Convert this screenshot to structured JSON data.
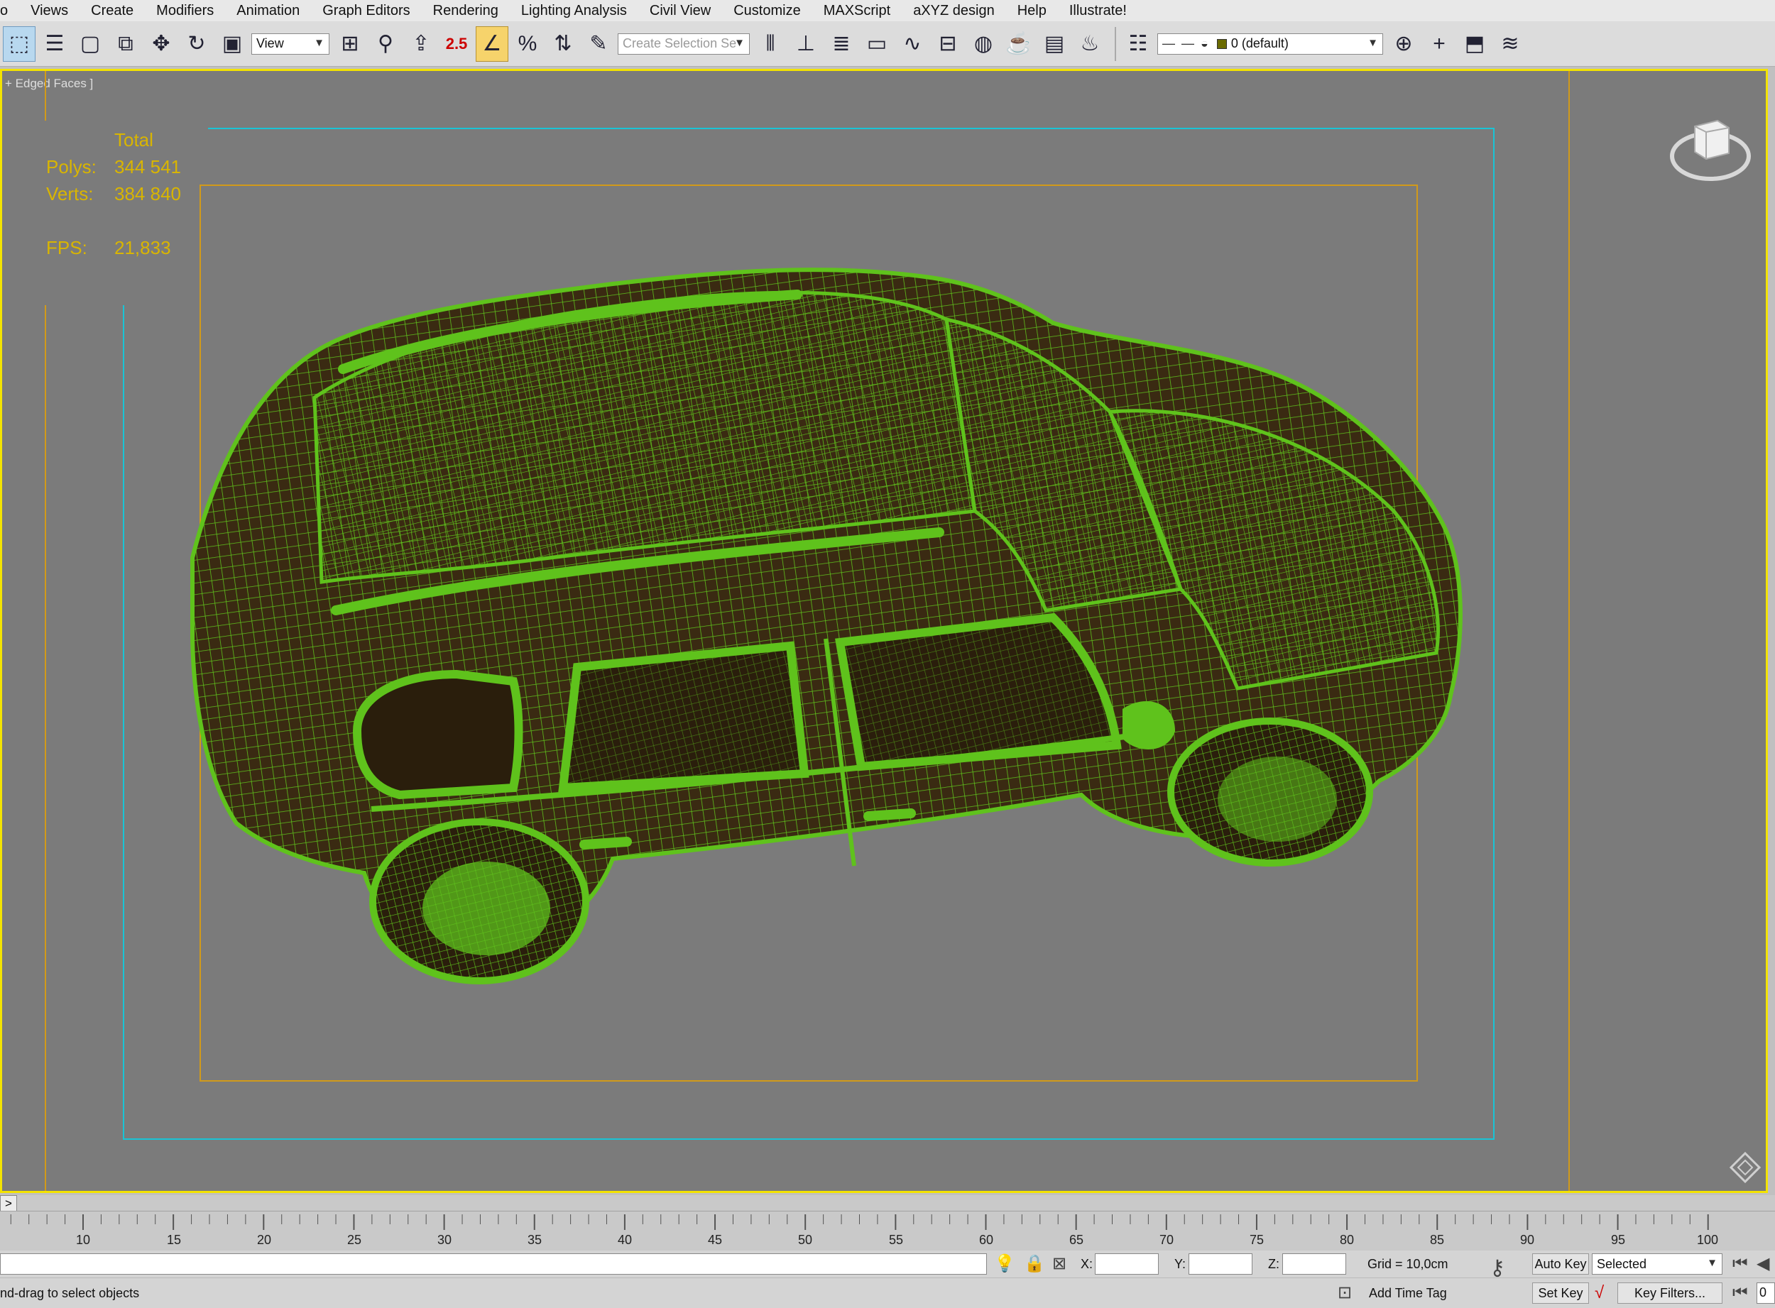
{
  "menu": {
    "items": [
      "o",
      "Views",
      "Create",
      "Modifiers",
      "Animation",
      "Graph Editors",
      "Rendering",
      "Lighting Analysis",
      "Civil View",
      "Customize",
      "MAXScript",
      "aXYZ design",
      "Help",
      "Illustrate!"
    ]
  },
  "toolbar": {
    "reference_coord": "View",
    "snap_label": "2.5",
    "named_selection_placeholder": "Create Selection Se",
    "layer_name": "0 (default)"
  },
  "viewport": {
    "label": "+ Edged Faces ]",
    "stats": {
      "header": "Total",
      "polys_label": "Polys:",
      "polys_value": "344 541",
      "verts_label": "Verts:",
      "verts_value": "384 840",
      "fps_label": "FPS:",
      "fps_value": "21,833"
    },
    "colors": {
      "background": "#7b7b7b",
      "border_active": "#f3e300",
      "wireframe": "#5fc21c",
      "safe_frame_outer": "#19c4d6",
      "safe_frame_inner": "#d19a1a",
      "stats_text": "#d9b500"
    }
  },
  "timeline": {
    "toggle": ">",
    "ticks": [
      "10",
      "15",
      "20",
      "25",
      "30",
      "35",
      "40",
      "45",
      "50",
      "55",
      "60",
      "65",
      "70",
      "75",
      "80",
      "85",
      "90",
      "95",
      "100"
    ]
  },
  "status": {
    "prompt": "nd-drag to select objects",
    "x_label": "X:",
    "y_label": "Y:",
    "z_label": "Z:",
    "grid": "Grid = 10,0cm",
    "add_time_tag": "Add Time Tag",
    "auto_key": "Auto Key",
    "set_key": "Set Key",
    "selected": "Selected",
    "key_filters": "Key Filters...",
    "frame_value": "0"
  }
}
